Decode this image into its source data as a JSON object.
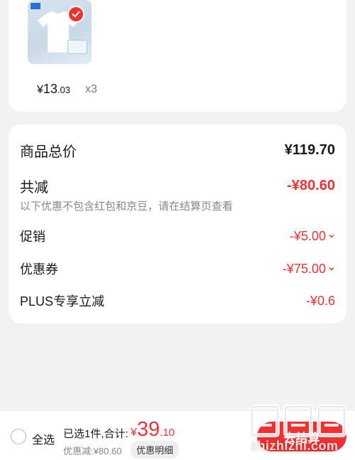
{
  "product": {
    "price_yen": "¥",
    "price_int": "13",
    "price_dec": ".03",
    "quantity": "x3",
    "thumb_icon": "white-tshirt-image",
    "selected_icon": "check-icon"
  },
  "summary": {
    "goods_total_label": "商品总价",
    "goods_total_value": "¥119.70",
    "total_reduce_label": "共减",
    "total_reduce_value": "-¥80.60",
    "note": "以下优惠不包含红包和京豆，请在结算页查看",
    "promo_label": "促销",
    "promo_value": "-¥5.00",
    "coupon_label": "优惠券",
    "coupon_value": "-¥75.00",
    "plus_label": "PLUS专享立减",
    "plus_value": "-¥0.6"
  },
  "bottom": {
    "select_all": "全选",
    "selected_info": "已选1件,合计:",
    "total_yen": "¥",
    "total_int": "39",
    "total_dec": ".10",
    "discount_info": "优惠减:¥80.60",
    "detail_button": "优惠明细",
    "checkout_button": "去结算"
  },
  "watermark": {
    "text": "zhizhizhi.com"
  },
  "colors": {
    "accent": "#f23030",
    "background": "#f2f2f2",
    "card": "#ffffff",
    "muted": "#888888"
  }
}
